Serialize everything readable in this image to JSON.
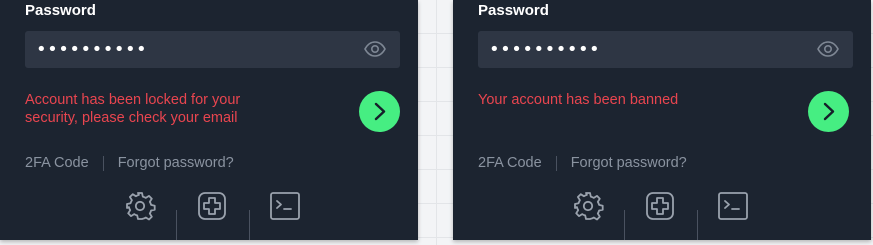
{
  "panels": [
    {
      "password_label": "Password",
      "password_value": "••••••••••",
      "error": "Account has been locked for your security, please check your email",
      "links": [
        "2FA Code",
        "Forgot password?"
      ]
    },
    {
      "password_label": "Password",
      "password_value": "••••••••••",
      "error": "Your account has been banned",
      "links": [
        "2FA Code",
        "Forgot password?"
      ]
    }
  ],
  "icons": {
    "eye": "eye-icon",
    "submit": "chevron-right-icon",
    "settings": "gear-icon",
    "add": "plus-square-icon",
    "console": "terminal-icon"
  },
  "colors": {
    "panel_bg": "#1c2430",
    "field_bg": "#2e3644",
    "error": "#e8454f",
    "accent": "#46ee82",
    "muted": "#8a93a0"
  }
}
